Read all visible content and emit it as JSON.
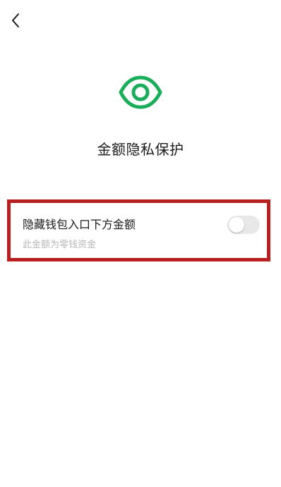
{
  "nav": {
    "back_icon": "chevron-left-icon"
  },
  "hero": {
    "icon": "eye-icon",
    "icon_color": "#1aad5a",
    "title": "金额隐私保护"
  },
  "setting": {
    "label": "隐藏钱包入口下方金额",
    "sub_label": "此金额为零钱资金",
    "toggle_on": false
  },
  "annotation": {
    "highlight_color": "#b82020"
  }
}
